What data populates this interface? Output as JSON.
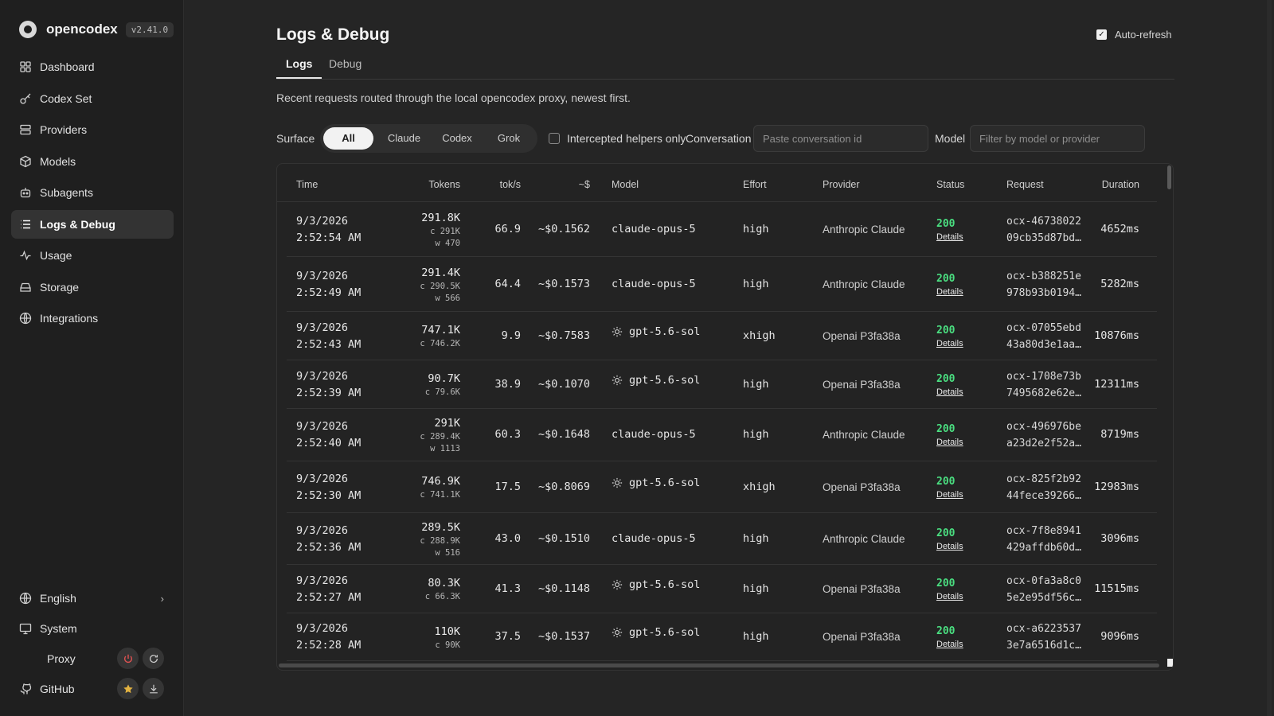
{
  "app": {
    "name": "opencodex",
    "version": "v2.41.0"
  },
  "sidebar": {
    "items": [
      {
        "label": "Dashboard",
        "icon": "grid-icon"
      },
      {
        "label": "Codex Set",
        "icon": "key-icon"
      },
      {
        "label": "Providers",
        "icon": "server-icon"
      },
      {
        "label": "Models",
        "icon": "cube-icon"
      },
      {
        "label": "Subagents",
        "icon": "robot-icon"
      },
      {
        "label": "Logs & Debug",
        "icon": "list-icon",
        "active": true
      },
      {
        "label": "Usage",
        "icon": "activity-icon"
      },
      {
        "label": "Storage",
        "icon": "storage-icon"
      },
      {
        "label": "Integrations",
        "icon": "globe-icon"
      }
    ],
    "language": "English",
    "system": "System",
    "proxy": "Proxy",
    "github": "GitHub"
  },
  "page": {
    "title": "Logs & Debug",
    "auto_refresh_label": "Auto-refresh",
    "auto_refresh_checked": true,
    "tabs": [
      {
        "label": "Logs",
        "active": true
      },
      {
        "label": "Debug",
        "active": false
      }
    ],
    "subtitle": "Recent requests routed through the local opencodex proxy, newest first."
  },
  "filters": {
    "surface_label": "Surface",
    "surface_options": [
      "All",
      "Claude",
      "Codex",
      "Grok"
    ],
    "surface_selected": "All",
    "intercepted_label": "Intercepted helpers only",
    "intercepted_checked": false,
    "conversation_label": "Conversation",
    "conversation_placeholder": "Paste conversation id",
    "model_label": "Model",
    "model_placeholder": "Filter by model or provider"
  },
  "table": {
    "columns": [
      "Time",
      "Tokens",
      "tok/s",
      "~$",
      "Model",
      "Effort",
      "Provider",
      "Status",
      "Request",
      "Duration"
    ],
    "rows": [
      {
        "date": "9/3/2026",
        "time": "2:52:54 AM",
        "tokens": "291.8K",
        "cached": "c 291K",
        "write": "w 470",
        "tps": "66.9",
        "cost": "~$0.1562",
        "model": "claude-opus-5",
        "model_icon": "",
        "effort": "high",
        "provider": "Anthropic Claude",
        "status": "200",
        "details": "Details",
        "req1": "ocx-46738022",
        "req2": "09cb35d87bd…",
        "duration": "4652ms"
      },
      {
        "date": "9/3/2026",
        "time": "2:52:49 AM",
        "tokens": "291.4K",
        "cached": "c 290.5K",
        "write": "w 566",
        "tps": "64.4",
        "cost": "~$0.1573",
        "model": "claude-opus-5",
        "model_icon": "",
        "effort": "high",
        "provider": "Anthropic Claude",
        "status": "200",
        "details": "Details",
        "req1": "ocx-b388251e",
        "req2": "978b93b0194…",
        "duration": "5282ms"
      },
      {
        "date": "9/3/2026",
        "time": "2:52:43 AM",
        "tokens": "747.1K",
        "cached": "c 746.2K",
        "write": "",
        "tps": "9.9",
        "cost": "~$0.7583",
        "model": "gpt-5.6-sol",
        "model_icon": "sun-icon",
        "effort": "xhigh",
        "provider": "Openai P3fa38a",
        "status": "200",
        "details": "Details",
        "req1": "ocx-07055ebd",
        "req2": "43a80d3e1aa…",
        "duration": "10876ms"
      },
      {
        "date": "9/3/2026",
        "time": "2:52:39 AM",
        "tokens": "90.7K",
        "cached": "c 79.6K",
        "write": "",
        "tps": "38.9",
        "cost": "~$0.1070",
        "model": "gpt-5.6-sol",
        "model_icon": "sun-icon",
        "effort": "high",
        "provider": "Openai P3fa38a",
        "status": "200",
        "details": "Details",
        "req1": "ocx-1708e73b",
        "req2": "7495682e62e…",
        "duration": "12311ms"
      },
      {
        "date": "9/3/2026",
        "time": "2:52:40 AM",
        "tokens": "291K",
        "cached": "c 289.4K",
        "write": "w 1113",
        "tps": "60.3",
        "cost": "~$0.1648",
        "model": "claude-opus-5",
        "model_icon": "",
        "effort": "high",
        "provider": "Anthropic Claude",
        "status": "200",
        "details": "Details",
        "req1": "ocx-496976be",
        "req2": "a23d2e2f52a…",
        "duration": "8719ms"
      },
      {
        "date": "9/3/2026",
        "time": "2:52:30 AM",
        "tokens": "746.9K",
        "cached": "c 741.1K",
        "write": "",
        "tps": "17.5",
        "cost": "~$0.8069",
        "model": "gpt-5.6-sol",
        "model_icon": "sun-icon",
        "effort": "xhigh",
        "provider": "Openai P3fa38a",
        "status": "200",
        "details": "Details",
        "req1": "ocx-825f2b92",
        "req2": "44fece39266…",
        "duration": "12983ms"
      },
      {
        "date": "9/3/2026",
        "time": "2:52:36 AM",
        "tokens": "289.5K",
        "cached": "c 288.9K",
        "write": "w 516",
        "tps": "43.0",
        "cost": "~$0.1510",
        "model": "claude-opus-5",
        "model_icon": "",
        "effort": "high",
        "provider": "Anthropic Claude",
        "status": "200",
        "details": "Details",
        "req1": "ocx-7f8e8941",
        "req2": "429affdb60d…",
        "duration": "3096ms"
      },
      {
        "date": "9/3/2026",
        "time": "2:52:27 AM",
        "tokens": "80.3K",
        "cached": "c 66.3K",
        "write": "",
        "tps": "41.3",
        "cost": "~$0.1148",
        "model": "gpt-5.6-sol",
        "model_icon": "sun-icon",
        "effort": "high",
        "provider": "Openai P3fa38a",
        "status": "200",
        "details": "Details",
        "req1": "ocx-0fa3a8c0",
        "req2": "5e2e95df56c…",
        "duration": "11515ms"
      },
      {
        "date": "9/3/2026",
        "time": "2:52:28 AM",
        "tokens": "110K",
        "cached": "c 90K",
        "write": "",
        "tps": "37.5",
        "cost": "~$0.1537",
        "model": "gpt-5.6-sol",
        "model_icon": "sun-icon",
        "effort": "high",
        "provider": "Openai P3fa38a",
        "status": "200",
        "details": "Details",
        "req1": "ocx-a6223537",
        "req2": "3e7a6516d1c…",
        "duration": "9096ms"
      }
    ]
  },
  "colors": {
    "status_ok": "#4ade80",
    "background": "#252525",
    "sidebar": "#1f1f1f"
  }
}
